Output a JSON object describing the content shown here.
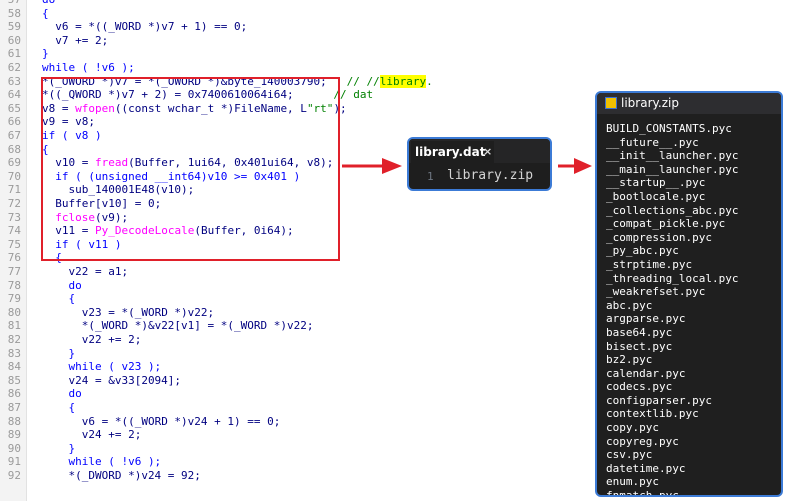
{
  "code_lines": [
    {
      "num": "57",
      "segments": [
        {
          "t": "do",
          "c": "kw"
        }
      ],
      "indent": 0
    },
    {
      "num": "58",
      "segments": [
        {
          "t": "{",
          "c": "kw"
        }
      ],
      "indent": 0
    },
    {
      "num": "59",
      "segments": [
        {
          "t": "v6 = *((_WORD *)v7 + 1) == 0;",
          "c": ""
        }
      ],
      "indent": 2
    },
    {
      "num": "60",
      "segments": [
        {
          "t": "v7 += 2;",
          "c": ""
        }
      ],
      "indent": 2
    },
    {
      "num": "61",
      "segments": [
        {
          "t": "}",
          "c": "kw"
        }
      ],
      "indent": 0
    },
    {
      "num": "62",
      "segments": [
        {
          "t": "while ( !v6 );",
          "c": "kw"
        }
      ],
      "indent": 0
    },
    {
      "num": "63",
      "segments": [
        {
          "t": "*(_OWORD *)v7 = *(_OWORD *)&byte_140003790;",
          "c": ""
        },
        {
          "t": "   // //",
          "c": "cm"
        },
        {
          "t": "library",
          "c": "cm hl"
        },
        {
          "t": ".",
          "c": "cm"
        }
      ],
      "indent": 0
    },
    {
      "num": "64",
      "segments": [
        {
          "t": "*((_QWORD *)v7 + 2) = 0x7400610064i64;",
          "c": ""
        },
        {
          "t": "      // dat",
          "c": "cm"
        }
      ],
      "indent": 0
    },
    {
      "num": "65",
      "segments": [
        {
          "t": "v8 = ",
          "c": ""
        },
        {
          "t": "wfopen",
          "c": "fn"
        },
        {
          "t": "((const wchar_t *)FileName, L",
          "c": ""
        },
        {
          "t": "\"rt\"",
          "c": "str"
        },
        {
          "t": ");",
          "c": ""
        }
      ],
      "indent": 0
    },
    {
      "num": "66",
      "segments": [
        {
          "t": "v9 = v8;",
          "c": ""
        }
      ],
      "indent": 0
    },
    {
      "num": "67",
      "segments": [
        {
          "t": "if ( v8 )",
          "c": "kw"
        }
      ],
      "indent": 0
    },
    {
      "num": "68",
      "segments": [
        {
          "t": "{",
          "c": "kw"
        }
      ],
      "indent": 0
    },
    {
      "num": "69",
      "segments": [
        {
          "t": "v10 = ",
          "c": ""
        },
        {
          "t": "fread",
          "c": "fn"
        },
        {
          "t": "(Buffer, 1ui64, 0x401ui64, v8);",
          "c": ""
        }
      ],
      "indent": 2
    },
    {
      "num": "70",
      "segments": [
        {
          "t": "if ( (unsigned __int64)v10 >= 0x401 )",
          "c": "kw"
        }
      ],
      "indent": 2
    },
    {
      "num": "71",
      "segments": [
        {
          "t": "sub_140001E48(v10);",
          "c": ""
        }
      ],
      "indent": 4
    },
    {
      "num": "72",
      "segments": [
        {
          "t": "Buffer[v10] = 0;",
          "c": ""
        }
      ],
      "indent": 2
    },
    {
      "num": "73",
      "segments": [
        {
          "t": "fclose",
          "c": "fn"
        },
        {
          "t": "(v9);",
          "c": ""
        }
      ],
      "indent": 2
    },
    {
      "num": "74",
      "segments": [
        {
          "t": "v11 = ",
          "c": ""
        },
        {
          "t": "Py_DecodeLocale",
          "c": "fn"
        },
        {
          "t": "(Buffer, 0i64);",
          "c": ""
        }
      ],
      "indent": 2
    },
    {
      "num": "75",
      "segments": [
        {
          "t": "if ( v11 )",
          "c": "kw"
        }
      ],
      "indent": 2
    },
    {
      "num": "76",
      "segments": [
        {
          "t": "{",
          "c": "kw"
        }
      ],
      "indent": 2
    },
    {
      "num": "77",
      "segments": [
        {
          "t": "v22 = a1;",
          "c": ""
        }
      ],
      "indent": 4
    },
    {
      "num": "78",
      "segments": [
        {
          "t": "do",
          "c": "kw"
        }
      ],
      "indent": 4
    },
    {
      "num": "79",
      "segments": [
        {
          "t": "{",
          "c": "kw"
        }
      ],
      "indent": 4
    },
    {
      "num": "80",
      "segments": [
        {
          "t": "v23 = *(_WORD *)v22;",
          "c": ""
        }
      ],
      "indent": 6
    },
    {
      "num": "81",
      "segments": [
        {
          "t": "*(_WORD *)&v22[v1] = *(_WORD *)v22;",
          "c": ""
        }
      ],
      "indent": 6
    },
    {
      "num": "82",
      "segments": [
        {
          "t": "v22 += 2;",
          "c": ""
        }
      ],
      "indent": 6
    },
    {
      "num": "83",
      "segments": [
        {
          "t": "}",
          "c": "kw"
        }
      ],
      "indent": 4
    },
    {
      "num": "84",
      "segments": [
        {
          "t": "while ( v23 );",
          "c": "kw"
        }
      ],
      "indent": 4
    },
    {
      "num": "85",
      "segments": [
        {
          "t": "v24 = &v33[2094];",
          "c": ""
        }
      ],
      "indent": 4
    },
    {
      "num": "86",
      "segments": [
        {
          "t": "do",
          "c": "kw"
        }
      ],
      "indent": 4
    },
    {
      "num": "87",
      "segments": [
        {
          "t": "{",
          "c": "kw"
        }
      ],
      "indent": 4
    },
    {
      "num": "88",
      "segments": [
        {
          "t": "v6 = *((_WORD *)v24 + 1) == 0;",
          "c": ""
        }
      ],
      "indent": 6
    },
    {
      "num": "89",
      "segments": [
        {
          "t": "v24 += 2;",
          "c": ""
        }
      ],
      "indent": 6
    },
    {
      "num": "90",
      "segments": [
        {
          "t": "}",
          "c": "kw"
        }
      ],
      "indent": 4
    },
    {
      "num": "91",
      "segments": [
        {
          "t": "while ( !v6 );",
          "c": "kw"
        }
      ],
      "indent": 4
    },
    {
      "num": "92",
      "segments": [
        {
          "t": "*(_DWORD *)v24 = 92;",
          "c": ""
        }
      ],
      "indent": 4
    }
  ],
  "tab_window": {
    "tab_label": "library.dat",
    "close_glyph": "×",
    "line_number": "1",
    "content": "library.zip"
  },
  "zip_window": {
    "title": "library.zip",
    "files": [
      "BUILD_CONSTANTS.pyc",
      "__future__.pyc",
      "__init__launcher.pyc",
      "__main__launcher.pyc",
      "__startup__.pyc",
      "_bootlocale.pyc",
      "_collections_abc.pyc",
      "_compat_pickle.pyc",
      "_compression.pyc",
      "_py_abc.pyc",
      "_strptime.pyc",
      "_threading_local.pyc",
      "_weakrefset.pyc",
      "abc.pyc",
      "argparse.pyc",
      "base64.pyc",
      "bisect.pyc",
      "bz2.pyc",
      "calendar.pyc",
      "codecs.pyc",
      "configparser.pyc",
      "contextlib.pyc",
      "copy.pyc",
      "copyreg.pyc",
      "csv.pyc",
      "datetime.pyc",
      "enum.pyc",
      "fnmatch.pyc"
    ]
  },
  "colors": {
    "annotation_red": "#e0202a",
    "window_border": "#3c7bd6",
    "highlight": "#ffff00"
  }
}
